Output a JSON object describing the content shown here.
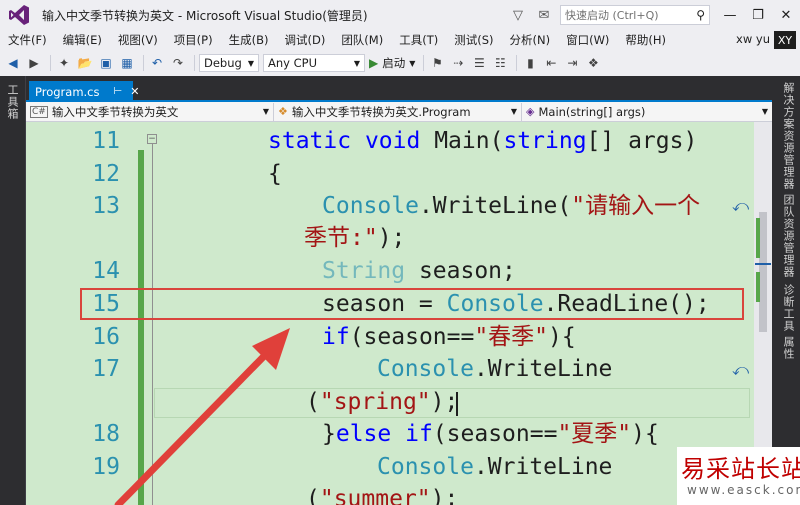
{
  "window": {
    "title": "输入中文季节转换为英文 - Microsoft Visual Studio(管理员)",
    "quick_launch_placeholder": "快速启动 (Ctrl+Q)",
    "user": "xw yu",
    "avatar": "XY"
  },
  "menu": {
    "items": [
      "文件(F)",
      "编辑(E)",
      "视图(V)",
      "项目(P)",
      "生成(B)",
      "调试(D)",
      "团队(M)",
      "工具(T)",
      "测试(S)",
      "分析(N)",
      "窗口(W)",
      "帮助(H)"
    ]
  },
  "toolbar": {
    "config": "Debug",
    "platform": "Any CPU",
    "start_label": "启动"
  },
  "left_strip": {
    "tab": "工具箱"
  },
  "right_strip": {
    "tabs": [
      "解决方案资源管理器",
      "团队资源管理器",
      "诊断工具",
      "属性"
    ]
  },
  "document": {
    "tab_label": "Program.cs",
    "nav_project": "输入中文季节转换为英文",
    "nav_class": "输入中文季节转换为英文.Program",
    "nav_member": "Main(string[] args)"
  },
  "code": {
    "line_numbers": [
      "11",
      "12",
      "13",
      "14",
      "15",
      "16",
      "17",
      "18",
      "19"
    ],
    "l11_kw1": "static",
    "l11_kw2": "void",
    "l11_name": "Main(",
    "l11_kw3": "string",
    "l11_rest": "[] args)",
    "l12": "{",
    "l13_type": "Console",
    "l13_call": ".WriteLine(",
    "l13_str1": "\"请输入一个",
    "l13_str2": "季节:\"",
    "l13_end": ");",
    "l14_type": "String",
    "l14_rest": " season;",
    "l15_var": "season = ",
    "l15_type": "Console",
    "l15_call": ".ReadLine();",
    "l16_kw": "if",
    "l16_cond": "(season==",
    "l16_str": "\"春季\"",
    "l16_end": "){",
    "l17_type": "Console",
    "l17_call": ".WriteLine",
    "l17b_open": "(",
    "l17b_str": "\"spring\"",
    "l17b_end": ");",
    "l18_open": "}",
    "l18_kw1": "else",
    "l18_kw2": "if",
    "l18_cond": "(season==",
    "l18_str": "\"夏季\"",
    "l18_end": "){",
    "l19_type": "Console",
    "l19_call": ".WriteLine",
    "l19b_open": "(",
    "l19b_str": "\"summer\"",
    "l19b_end": ");"
  },
  "watermark": {
    "name": "易采站长站",
    "url": "www.easck.com"
  },
  "colors": {
    "accent": "#007acc",
    "editor_bg": "#cfe9cc",
    "keyword": "#0000ff",
    "type": "#2b91af",
    "string": "#a31515",
    "highlight": "#d9453c"
  }
}
